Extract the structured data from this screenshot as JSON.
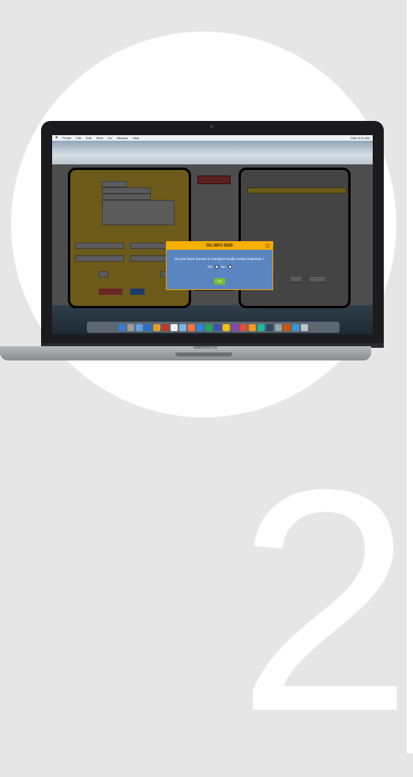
{
  "step": {
    "number": "2"
  },
  "laptop": {
    "brand": "MacBook Pro"
  },
  "menubar": {
    "items": [
      "Finder",
      "File",
      "Edit",
      "View",
      "Go",
      "Window",
      "Help"
    ],
    "clock": "Mon 8:41 AM"
  },
  "dialog": {
    "title": "DG INFO 0030",
    "question": "Do you have license to transport Radio active materials ?",
    "option_yes": "Yes",
    "option_no": "No",
    "ok_label": "OK"
  },
  "colors": {
    "background": "#e6e6e6",
    "dialog_header": "#f5b000",
    "dialog_body": "#5a85c0",
    "ok_button": "#7dbf2c"
  },
  "dock": {
    "icons": [
      "#3a7bd5",
      "#9a9a9a",
      "#5aa0e0",
      "#2a6fc9",
      "#e0a030",
      "#c0352b",
      "#f0f0f0",
      "#7fb3e8",
      "#ff6f3c",
      "#2e86de",
      "#26a65b",
      "#3f51b5",
      "#f1c40f",
      "#8e44ad",
      "#e74c3c",
      "#f39c12",
      "#1abc9c",
      "#34495e",
      "#95a5a6",
      "#d35400",
      "#3498db",
      "#bdc3c7"
    ]
  }
}
